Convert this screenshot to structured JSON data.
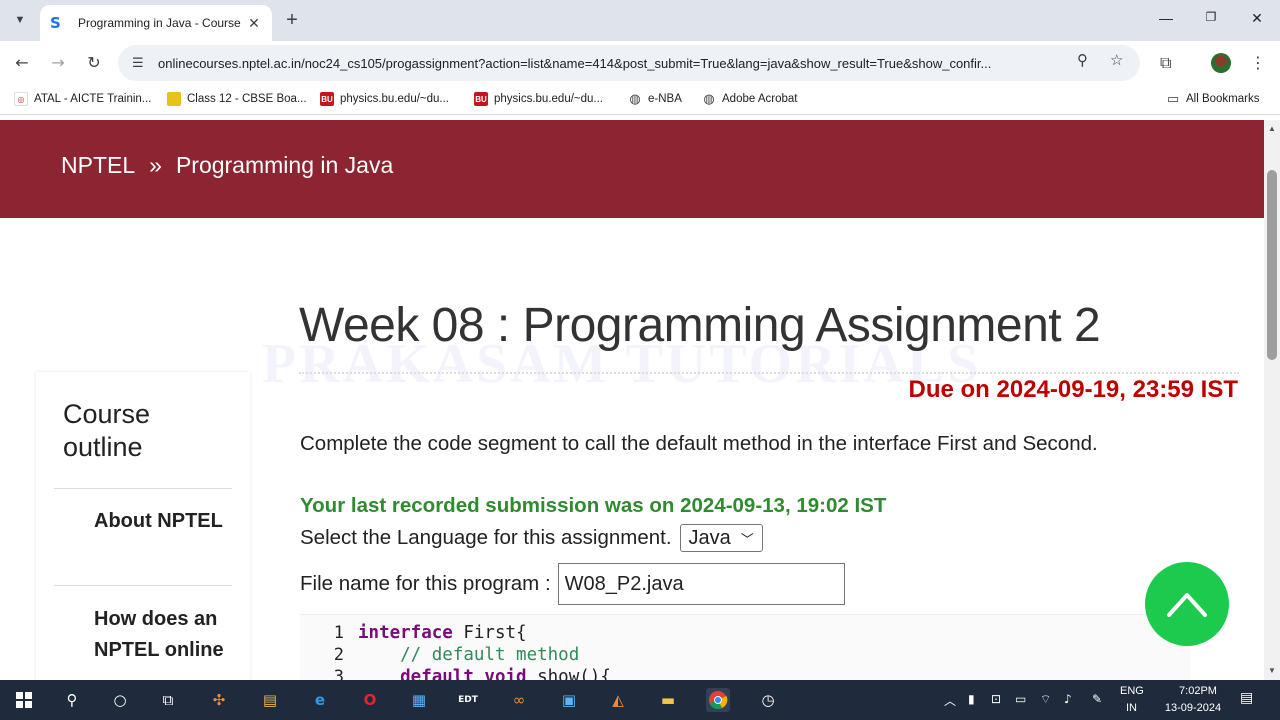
{
  "browser": {
    "tab_title": "Programming in Java - Course",
    "url": "onlinecourses.nptel.ac.in/noc24_cs105/progassignment?action=list&name=414&post_submit=True&lang=java&show_result=True&show_confir...",
    "bookmarks": [
      {
        "label": "ATAL - AICTE Trainin...",
        "icon": "atal-icon"
      },
      {
        "label": "Class 12 - CBSE Boa...",
        "icon": "cbse-icon"
      },
      {
        "label": "physics.bu.edu/~du...",
        "icon": "bu-icon",
        "badge": "BU"
      },
      {
        "label": "physics.bu.edu/~du...",
        "icon": "bu-icon",
        "badge": "BU"
      },
      {
        "label": "e-NBA",
        "icon": "globe-icon"
      },
      {
        "label": "Adobe Acrobat",
        "icon": "globe-icon"
      }
    ],
    "all_bookmarks": "All Bookmarks"
  },
  "page": {
    "breadcrumb": {
      "root": "NPTEL",
      "sep": "»",
      "current": "Programming in Java"
    },
    "watermark": "PRAKASAM TUTORIALS",
    "title": "Week 08 : Programming Assignment 2",
    "due": "Due on 2024-09-19, 23:59 IST",
    "description": "Complete the code segment to call the default method in the interface First and Second.",
    "last_submission": "Your last recorded submission was on 2024-09-13, 19:02 IST",
    "language_label": "Select the Language for this assignment.",
    "language_value": "Java",
    "filename_label": "File name for this program :",
    "filename_value": "W08_P2.java"
  },
  "sidebar": {
    "heading": "Course outline",
    "items": [
      "About NPTEL",
      "How does an NPTEL online"
    ]
  },
  "code": {
    "lines": [
      {
        "n": "1",
        "kw": "interface",
        "rest": " First{"
      },
      {
        "n": "2",
        "comment": "    // default method"
      },
      {
        "n": "3",
        "kw": "    default void",
        "rest": " show(){"
      }
    ]
  },
  "taskbar": {
    "lang1": "ENG",
    "lang2": "IN",
    "time": "7:02PM",
    "date": "13-09-2024",
    "edt_label": "EDT"
  },
  "colors": {
    "banner": "#8d2432",
    "due": "#c00000",
    "submission": "#2e8b2e",
    "totop": "#1ccb4d"
  }
}
